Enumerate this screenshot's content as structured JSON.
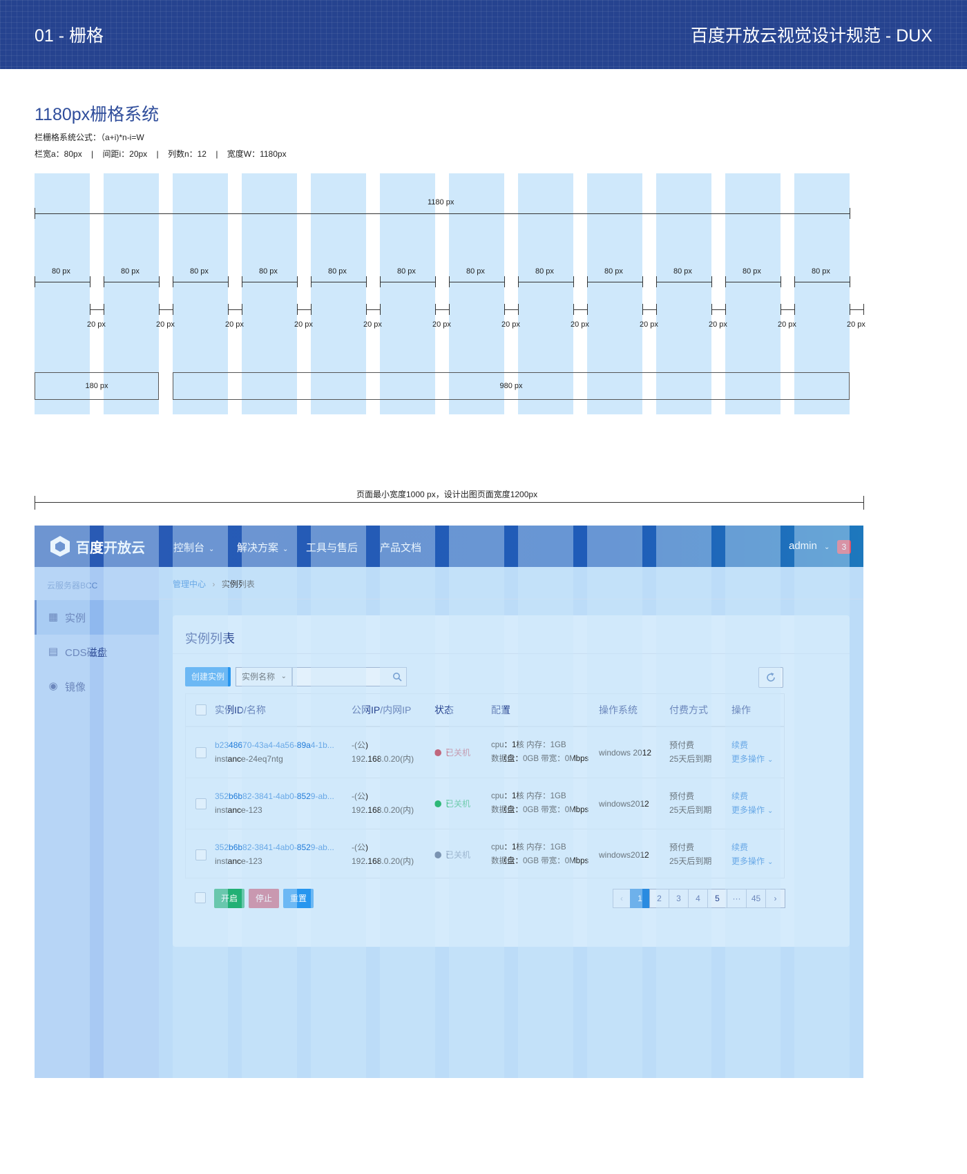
{
  "banner": {
    "left": "01 - 栅格",
    "right": "百度开放云视觉设计规范 - DUX"
  },
  "grid": {
    "title": "1180px栅格系统",
    "formula": "栏栅格系统公式：（a+i)*n-i=W",
    "params": "栏宽a：80px    |    间距i：20px    |    列数n：12    |    宽度W：1180px",
    "total_label": "1180 px",
    "col_label": "80 px",
    "gutter_label": "20 px",
    "box_left": "180 px",
    "box_right": "980 px"
  },
  "page_width_note": "页面最小宽度1000 px，设计出图页面宽度1200px",
  "app": {
    "logo": "百度开放云",
    "nav": [
      {
        "label": "控制台"
      },
      {
        "label": "解决方案"
      },
      {
        "label": "工具与售后"
      },
      {
        "label": "产品文档"
      }
    ],
    "user": "admin",
    "badge": "3",
    "sidebar_title": "云服务器BCC",
    "sidebar_items": [
      {
        "label": "实例",
        "icon": "grid-icon"
      },
      {
        "label": "CDS磁盘",
        "icon": "disk-icon"
      },
      {
        "label": "镜像",
        "icon": "image-icon"
      }
    ],
    "breadcrumb": {
      "parent": "管理中心",
      "current": "实例列表"
    },
    "panel_title": "实例列表",
    "create_button": "创建实例",
    "search_select": "实例名称",
    "search_placeholder": "",
    "table": {
      "headers": [
        "实例ID/名称",
        "公网IP/内网IP",
        "状态",
        "配置",
        "操作系统",
        "付费方式",
        "操作"
      ],
      "rows": [
        {
          "id": "b2348670-43a4-4a56-89a4-1b...",
          "name": "instance-24eq7ntg",
          "ip_pub": "-(公)",
          "ip_priv": "192.168.0.20(内)",
          "status": "已关机",
          "status_color": "#c0677d",
          "cfg1": "cpu：1核 内存：1GB",
          "cfg2": "数据盘：0GB 带宽：0Mbps",
          "os": "windows 2012",
          "pay1": "预付费",
          "pay2": "25天后到期",
          "op1": "续费",
          "op2": "更多操作"
        },
        {
          "id": "352b6b82-3841-4ab0-8529-ab...",
          "name": "instance-123",
          "ip_pub": "-(公)",
          "ip_priv": "192.168.0.20(内)",
          "status": "已关机",
          "status_color": "#2eb877",
          "cfg1": "cpu：1核 内存：1GB",
          "cfg2": "数据盘：0GB 带宽：0Mbps",
          "os": "windows2012",
          "pay1": "预付费",
          "pay2": "25天后到期",
          "op1": "续费",
          "op2": "更多操作"
        },
        {
          "id": "352b6b82-3841-4ab0-8529-ab...",
          "name": "instance-123",
          "ip_pub": "-(公)",
          "ip_priv": "192.168.0.20(内)",
          "status": "已关机",
          "status_color": "#7a93b1",
          "cfg1": "cpu：1核 内存：1GB",
          "cfg2": "数据盘：0GB 带宽：0Mbps",
          "os": "windows2012",
          "pay1": "预付费",
          "pay2": "25天后到期",
          "op1": "续费",
          "op2": "更多操作"
        }
      ]
    },
    "actions": {
      "start": "开启",
      "stop": "停止",
      "reset": "重置"
    },
    "colors": {
      "start": "#21b075",
      "stop": "#c7607a",
      "reset": "#2796ef",
      "primary": "#2796ef"
    },
    "pagination": {
      "prev": "‹",
      "pages": [
        "1",
        "2",
        "3",
        "4",
        "5",
        "···",
        "45"
      ],
      "next": "›",
      "active": "1"
    }
  }
}
